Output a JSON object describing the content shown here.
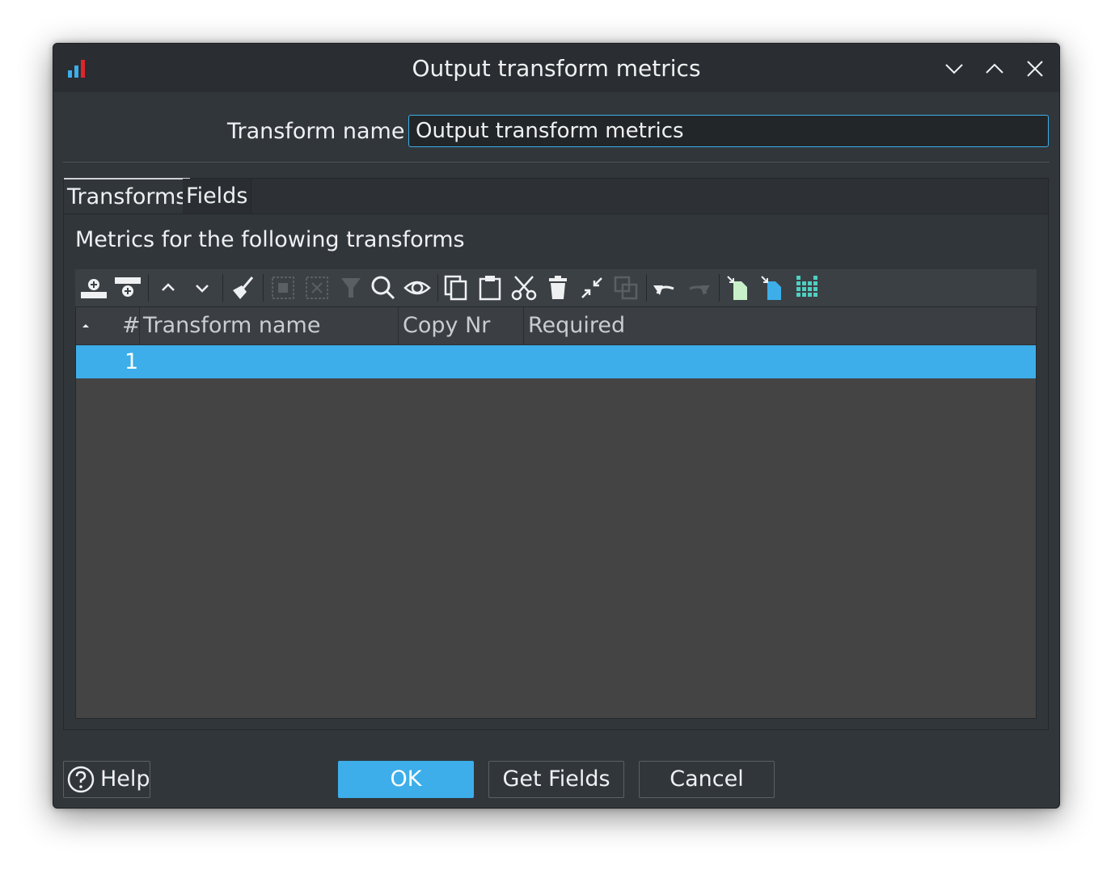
{
  "window": {
    "title": "Output transform metrics",
    "controls": [
      "minimize",
      "maximize",
      "close"
    ]
  },
  "form": {
    "transform_name_label": "Transform name",
    "transform_name_value": "Output transform metrics"
  },
  "tabs": [
    {
      "label": "Transforms",
      "active": true
    },
    {
      "label": "Fields",
      "active": false
    }
  ],
  "transforms_tab": {
    "heading": "Metrics for the following transforms",
    "toolbar": [
      {
        "name": "insert-row-before-icon",
        "enabled": true
      },
      {
        "name": "insert-row-after-icon",
        "enabled": true
      },
      {
        "name": "move-up-icon",
        "enabled": true
      },
      {
        "name": "move-down-icon",
        "enabled": true
      },
      {
        "name": "clean-icon",
        "enabled": true
      },
      {
        "name": "select-all-icon",
        "enabled": false
      },
      {
        "name": "clear-selection-icon",
        "enabled": false
      },
      {
        "name": "filter-icon",
        "enabled": false
      },
      {
        "name": "search-icon",
        "enabled": true
      },
      {
        "name": "show-icon",
        "enabled": true
      },
      {
        "name": "copy-icon",
        "enabled": true
      },
      {
        "name": "paste-icon",
        "enabled": true
      },
      {
        "name": "cut-icon",
        "enabled": true
      },
      {
        "name": "delete-icon",
        "enabled": true
      },
      {
        "name": "keep-icon",
        "enabled": true
      },
      {
        "name": "duplicate-icon",
        "enabled": false
      },
      {
        "name": "undo-icon",
        "enabled": true
      },
      {
        "name": "redo-icon",
        "enabled": false
      },
      {
        "name": "import-file-icon",
        "enabled": true
      },
      {
        "name": "export-file-icon",
        "enabled": true
      },
      {
        "name": "column-grid-icon",
        "enabled": true
      }
    ],
    "table": {
      "columns": [
        "#",
        "Transform name",
        "Copy Nr",
        "Required"
      ],
      "rows": [
        {
          "num": "1",
          "transform_name": "",
          "copy_nr": "",
          "required": "",
          "selected": true
        }
      ]
    }
  },
  "buttons": {
    "help": "Help",
    "ok": "OK",
    "get_fields": "Get Fields",
    "cancel": "Cancel"
  },
  "colors": {
    "accent": "#3daee9",
    "window_bg": "#31363b",
    "grid_bg": "#444444"
  }
}
